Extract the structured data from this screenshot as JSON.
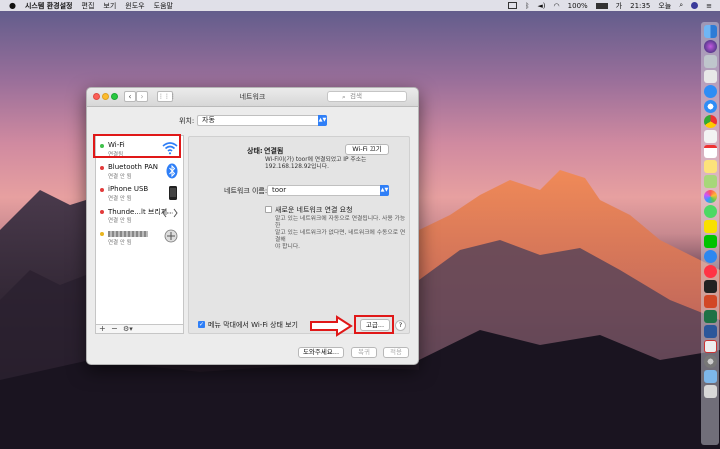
{
  "menubar": {
    "apple": "",
    "app_name": "시스템 환경설정",
    "menus": [
      "편집",
      "보기",
      "윈도우",
      "도움말"
    ],
    "battery": "100%",
    "time": "21:35",
    "user": "오늘"
  },
  "window": {
    "title": "네트워크",
    "search_placeholder": "검색",
    "location_label": "위치:",
    "location_value": "자동"
  },
  "services": [
    {
      "name": "Wi-Fi",
      "status": "연결됨",
      "color": "#3fc04a",
      "icon": "wifi-icon"
    },
    {
      "name": "Bluetooth PAN",
      "status": "연결 안 됨",
      "color": "#e23b3b",
      "icon": "bluetooth-icon"
    },
    {
      "name": "iPhone USB",
      "status": "연결 안 됨",
      "color": "#e23b3b",
      "icon": "iphone-icon"
    },
    {
      "name": "Thunde...lt 브리지",
      "status": "연결 안 됨",
      "color": "#e23b3b",
      "icon": "thunderbolt-bridge-icon"
    },
    {
      "name": "",
      "status": "연결 안 됨",
      "color": "#e9b51f",
      "icon": "vpn-icon"
    }
  ],
  "sidebar_controls": {
    "add": "+",
    "remove": "−",
    "gear": "⚙▾"
  },
  "status": {
    "label": "상태:",
    "value": "연결됨",
    "wifi_off_button": "Wi-Fi 끄기",
    "description_line1": "Wi-Fi이(가) toor에 연결되었고 IP 주소는",
    "description_line2": "192.168.128.92입니다."
  },
  "network_name": {
    "label": "네트워크 이름:",
    "value": "toor"
  },
  "ask_join": {
    "label": "새로운 네트워크 연결 요청",
    "desc_line1": "알고 있는 네트워크에 자동으로 연결됩니다. 사용 가능한",
    "desc_line2": "알고 있는 네트워크가 없다면, 네트워크에 수동으로 연결해",
    "desc_line3": "야 합니다."
  },
  "show_in_menubar": {
    "label": "메뉴 막대에서 Wi-Fi 상태 보기",
    "checked": true
  },
  "buttons": {
    "advanced": "고급...",
    "help": "?",
    "assist": "도와주세요...",
    "revert": "복귀",
    "apply": "적용"
  },
  "colors": {
    "accent": "#2f7ff7",
    "annotation_red": "#e01818"
  }
}
